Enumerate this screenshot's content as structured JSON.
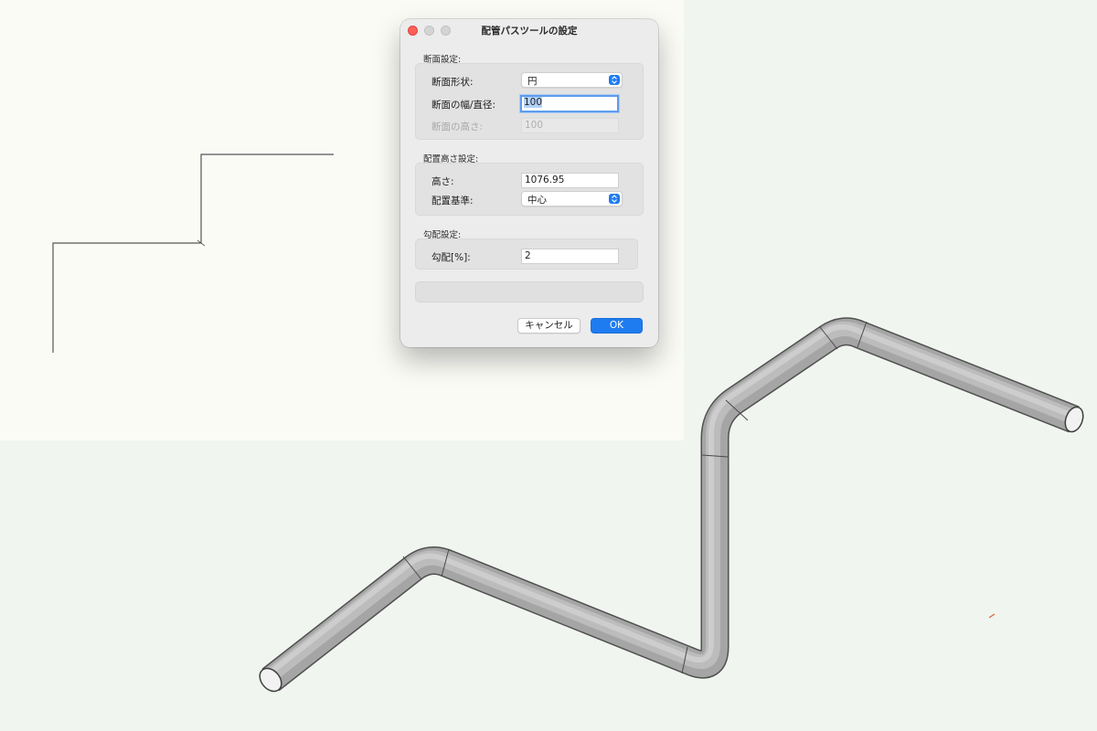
{
  "dialog": {
    "title": "配管パスツールの設定",
    "section_profile": {
      "label": "断面設定:",
      "shape_label": "断面形状:",
      "shape_value": "円",
      "width_label": "断面の幅/直径:",
      "width_value": "100",
      "height_label": "断面の高さ:",
      "height_value": "100"
    },
    "section_placement": {
      "label": "配置高さ設定:",
      "height_label": "高さ:",
      "height_value": "1076.95",
      "reference_label": "配置基準:",
      "reference_value": "中心"
    },
    "section_slope": {
      "label": "勾配設定:",
      "slope_label": "勾配[%]:",
      "slope_value": "2"
    },
    "cancel_label": "キャンセル",
    "ok_label": "OK"
  },
  "colors": {
    "accent": "#1f7cf0",
    "close": "#fe5f57",
    "pipe": "#9d9d9d",
    "plan_background": "#fbfbf6",
    "view_background": "#f0f5ef"
  },
  "icons": {
    "select_arrows": "updown-chevron-icon"
  }
}
